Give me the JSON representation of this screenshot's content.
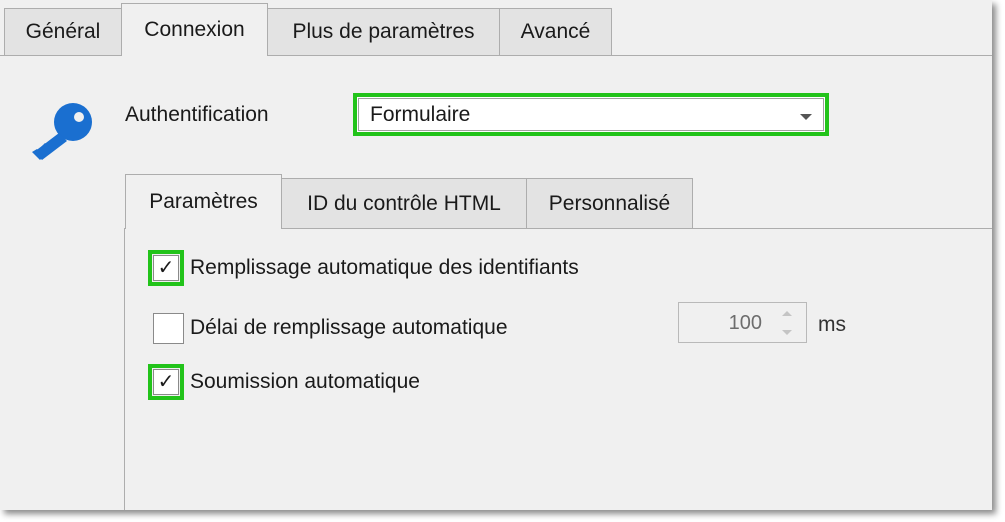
{
  "tabs": {
    "general": "Général",
    "connexion": "Connexion",
    "plus": "Plus de paramètres",
    "avance": "Avancé"
  },
  "auth": {
    "label": "Authentification",
    "selected": "Formulaire"
  },
  "subtabs": {
    "parametres": "Paramètres",
    "id_controle": "ID du contrôle HTML",
    "personnalise": "Personnalisé"
  },
  "options": {
    "autofill": {
      "label": "Remplissage automatique des identifiants",
      "checked": true,
      "mark": "✓"
    },
    "delay": {
      "label": "Délai de remplissage automatique",
      "checked": false,
      "mark": ""
    },
    "autosubmit": {
      "label": "Soumission automatique",
      "checked": true,
      "mark": "✓"
    }
  },
  "delay": {
    "value": "100",
    "unit": "ms"
  },
  "colors": {
    "highlight": "#22c31a",
    "key_icon": "#1a6fd0"
  },
  "icons": {
    "key": "key-icon"
  }
}
